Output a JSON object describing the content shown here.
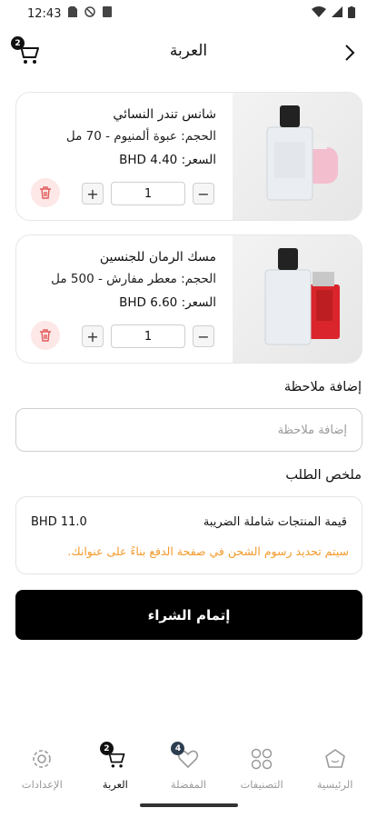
{
  "status": {
    "time": "12:43"
  },
  "header": {
    "title": "العربة",
    "cart_count": "2"
  },
  "items": [
    {
      "name": "شانس تندر النسائي",
      "size": "الحجم: عبوة ألمنيوم - 70 مل",
      "price": "السعر: BHD 4.40",
      "quantity": "1"
    },
    {
      "name": "مسك الرمان للجنسين",
      "size": "الحجم: معطر مفارش - 500 مل",
      "price": "السعر: BHD 6.60",
      "quantity": "1"
    }
  ],
  "note": {
    "label": "إضافة ملاحظة",
    "placeholder": "إضافة ملاحظة"
  },
  "summary": {
    "label": "ملخص الطلب",
    "products_label": "قيمة المنتجات شاملة الضريبة",
    "products_value": "BHD 11.0",
    "shipping_note": "سيتم تحديد رسوم الشحن في صفحة الدفع بناءً على عنوانك."
  },
  "checkout_label": "إتمام الشراء",
  "nav": {
    "home": "الرئيسية",
    "categories": "التصنيفات",
    "favorites": "المفضلة",
    "favorites_count": "4",
    "cart": "العربة",
    "cart_count": "2",
    "settings": "الإعدادات"
  },
  "colors": {
    "accent": "#000000",
    "shipping_note": "#f39a2b",
    "trash_bg": "#fde7e7",
    "trash_icon": "#e25b5b"
  }
}
